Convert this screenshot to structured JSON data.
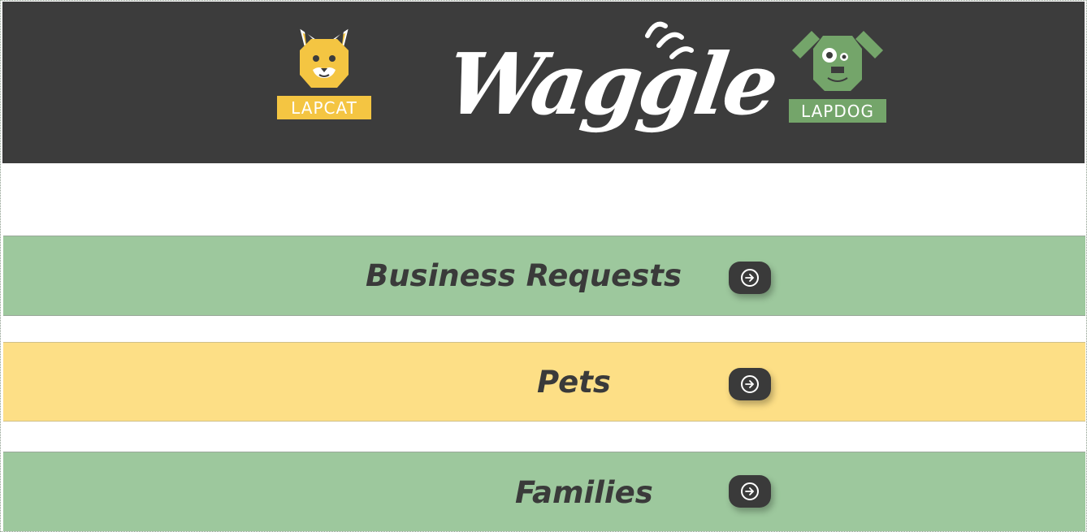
{
  "header": {
    "brand_name": "Waggle",
    "cat_logo": {
      "label": "LAPCAT",
      "icon": "cat-face-icon",
      "color": "#f4c542"
    },
    "dog_logo": {
      "label": "LAPDOG",
      "icon": "dog-face-icon",
      "color": "#74a56a"
    },
    "background": "#3c3c3c"
  },
  "menu": {
    "items": [
      {
        "label": "Business Requests",
        "color": "#9dc89d",
        "icon": "arrow-right-icon"
      },
      {
        "label": "Pets",
        "color": "#fddf86",
        "icon": "arrow-right-icon"
      },
      {
        "label": "Families",
        "color": "#9dc89d",
        "icon": "arrow-right-icon"
      }
    ]
  }
}
